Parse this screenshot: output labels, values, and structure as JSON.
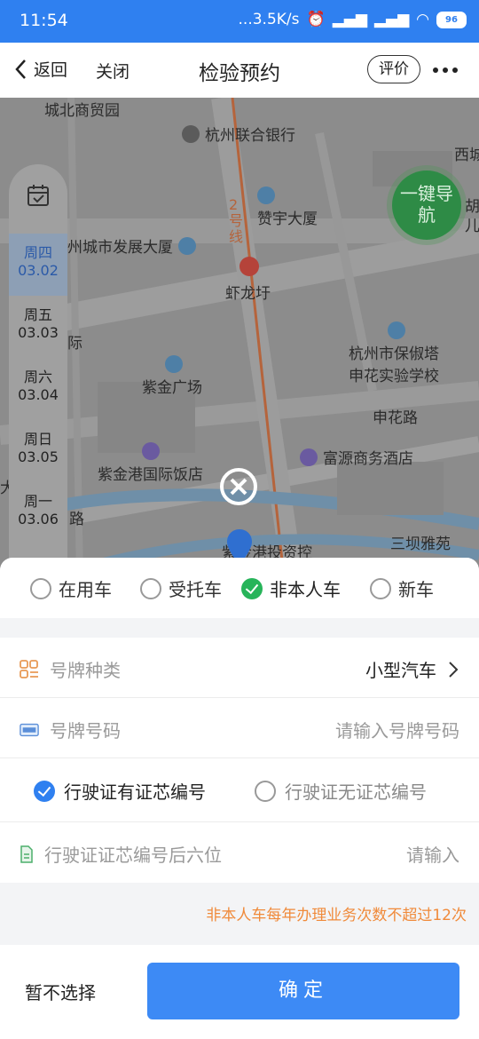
{
  "status_bar": {
    "time": "11:54",
    "network": "...3.5K/s",
    "battery": "96"
  },
  "header": {
    "back_label": "返回",
    "close_label": "关闭",
    "title": "检验预约",
    "rate_label": "评价"
  },
  "map": {
    "labels": {
      "l1": "城北商贸园",
      "l2": "杭州联合银行",
      "l3": "西城",
      "l4": "2号线",
      "l5": "赞宇大厦",
      "l6": "州城市发展大厦",
      "l7": "虾龙圩",
      "l8": "杭州市保俶塔",
      "l9": "申花实验学校",
      "l10": "紫金广场",
      "l11": "申花路",
      "l12": "紫金港国际饭店",
      "l13": "富源商务酒店",
      "l14": "三坝雅苑",
      "l15": "紫金港投资控",
      "l16": "路",
      "l17": "胡",
      "l18": "儿",
      "l19": "际",
      "l20": "大"
    },
    "nav_button": "一键导航",
    "dates": [
      {
        "day": "周四",
        "date": "03.02"
      },
      {
        "day": "周五",
        "date": "03.03"
      },
      {
        "day": "周六",
        "date": "03.04"
      },
      {
        "day": "周日",
        "date": "03.05"
      },
      {
        "day": "周一",
        "date": "03.06"
      }
    ]
  },
  "car_types": [
    "在用车",
    "受托车",
    "非本人车",
    "新车"
  ],
  "selected_car_type": "非本人车",
  "form": {
    "plate_type": {
      "label": "号牌种类",
      "value": "小型汽车"
    },
    "plate_number": {
      "label": "号牌号码",
      "placeholder": "请输入号牌号码"
    },
    "chip_options": [
      "行驶证有证芯编号",
      "行驶证无证芯编号"
    ],
    "chip_selected": "行驶证有证芯编号",
    "chip_number": {
      "label": "行驶证证芯编号后六位",
      "placeholder": "请输入"
    }
  },
  "notice": "非本人车每年办理业务次数不超过12次",
  "footer": {
    "skip_label": "暂不选择",
    "confirm_label": "确定"
  },
  "colors": {
    "primary": "#3d8af5",
    "green": "#27b45a",
    "notice": "#f08a3a"
  }
}
